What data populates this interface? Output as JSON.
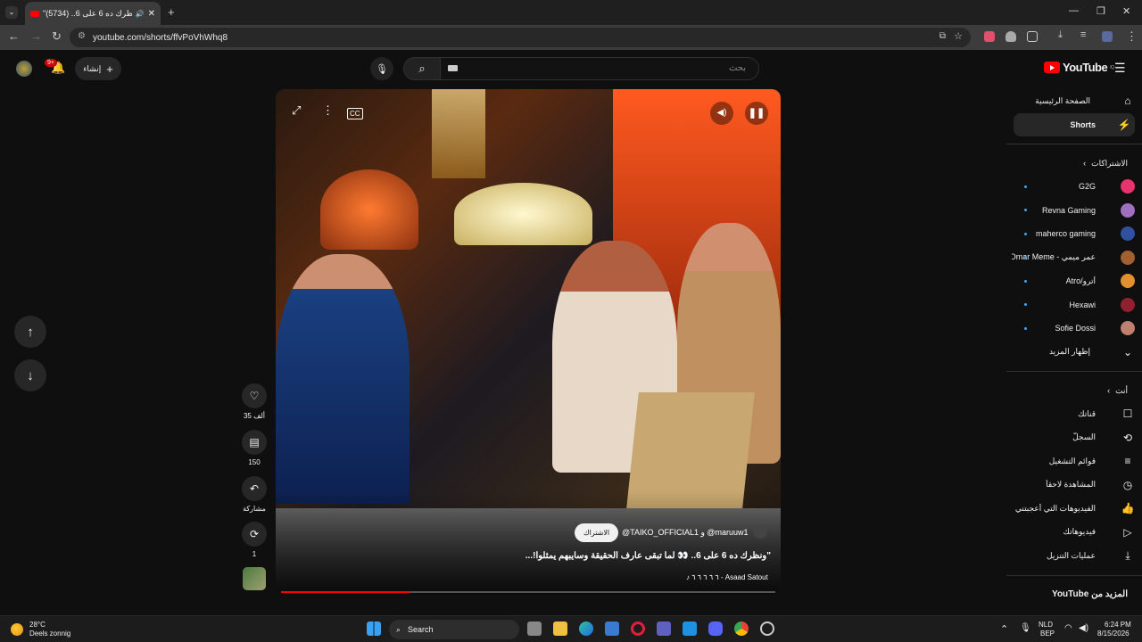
{
  "browser": {
    "tab_title": "\"ونظرك ده 6 على 6.. (5734) !",
    "url": "youtube.com/shorts/ffvPoVhWhq8"
  },
  "youtube": {
    "logo_text": "YouTube",
    "logo_country": "IQ",
    "search_placeholder": "بحث",
    "create_label": "إنشاء",
    "notif_count": "9+"
  },
  "sidebar": {
    "home": "الصفحة الرئيسية",
    "shorts": "Shorts",
    "subscriptions_header": "الاشتراكات",
    "channels": [
      {
        "name": "G2G",
        "color": "#e8336e"
      },
      {
        "name": "Revna Gaming",
        "color": "#a070c0"
      },
      {
        "name": "maherco gaming",
        "color": "#3050a0"
      },
      {
        "name": "عمر ميمي - Omar Meme...",
        "color": "#a06030"
      },
      {
        "name": "أترو/Atro",
        "color": "#e09030"
      },
      {
        "name": "Hexawi",
        "color": "#902030"
      },
      {
        "name": "Sofie Dossi",
        "color": "#c08070"
      }
    ],
    "show_more": "إظهار المزيد",
    "you_header": "أنت",
    "you_items": [
      {
        "label": "قناتك",
        "icon": "channel-icon"
      },
      {
        "label": "السجلّ",
        "icon": "history-icon"
      },
      {
        "label": "قوائم التشغيل",
        "icon": "playlists-icon"
      },
      {
        "label": "المشاهدة لاحقاً",
        "icon": "watch-later-icon"
      },
      {
        "label": "الفيديوهات التي أعجبتني",
        "icon": "liked-icon"
      },
      {
        "label": "فيديوهاتك",
        "icon": "your-videos-icon"
      },
      {
        "label": "عمليات التنزيل",
        "icon": "downloads-icon"
      }
    ],
    "more_from": "المزيد من YouTube"
  },
  "video": {
    "channels_line": "@TAIKO_OFFICIAL1 و @maruuw1",
    "subscribe_label": "الاشتراك",
    "caption": "\"ونظرك ده 6 على 6.. 👀 لما تبقى عارف الحقيقة وسايبهم يمثلوا!...",
    "music": "♪ ٦ ٦ ٦ ٦ ٦ - Asaad Satout",
    "progress": 0.26
  },
  "actions": {
    "likes": "35 ألف",
    "comments": "150",
    "share": "مشاركة",
    "remix": "1"
  },
  "taskbar": {
    "weather_temp": "28°C",
    "weather_desc": "Deels zonnig",
    "search_label": "Search",
    "lang_top": "NLD",
    "lang_bottom": "BEP",
    "time": "6:24 PM",
    "date": "8/15/2026"
  }
}
